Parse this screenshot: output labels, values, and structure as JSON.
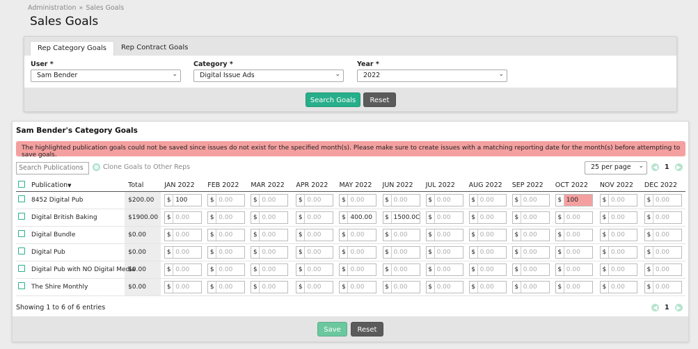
{
  "breadcrumb": {
    "parent": "Administration",
    "separator": "»",
    "current": "Sales Goals"
  },
  "page_title": "Sales Goals",
  "tabs": [
    {
      "label": "Rep Category Goals",
      "active": true
    },
    {
      "label": "Rep Contract Goals",
      "active": false
    }
  ],
  "filters": {
    "user": {
      "label": "User *",
      "value": "Sam Bender"
    },
    "category": {
      "label": "Category *",
      "value": "Digital Issue Ads"
    },
    "year": {
      "label": "Year *",
      "value": "2022"
    }
  },
  "buttons": {
    "search": "Search Goals",
    "reset": "Reset",
    "save": "Save",
    "reset_bottom": "Reset"
  },
  "goals": {
    "title": "Sam Bender's Category Goals",
    "alert": "The highlighted publication goals could not be saved since issues do not exist for the specified month(s). Please make sure to create issues with a matching reporting date for the month(s) before attempting to save goals.",
    "search_placeholder": "Search Publications",
    "clone_label": "Clone Goals to Other Reps",
    "per_page": "25 per page",
    "page": "1",
    "showing": "Showing 1 to 6 of 6 entries",
    "currency": "$",
    "placeholder": "0.00",
    "columns": {
      "publication": "Publication",
      "total": "Total",
      "months": [
        "JAN 2022",
        "FEB 2022",
        "MAR 2022",
        "APR 2022",
        "MAY 2022",
        "JUN 2022",
        "JUL 2022",
        "AUG 2022",
        "SEP 2022",
        "OCT 2022",
        "NOV 2022",
        "DEC 2022"
      ]
    },
    "rows": [
      {
        "publication": "8452 Digital Pub",
        "total": "$200.00",
        "months": [
          "100",
          "",
          "",
          "",
          "",
          "",
          "",
          "",
          "",
          "100",
          "",
          ""
        ],
        "errors": [
          9
        ]
      },
      {
        "publication": "Digital British Baking",
        "total": "$1900.00",
        "months": [
          "",
          "",
          "",
          "",
          "400.00",
          "1500.0C",
          "",
          "",
          "",
          "",
          "",
          ""
        ],
        "errors": []
      },
      {
        "publication": "Digital Bundle",
        "total": "$0.00",
        "months": [
          "",
          "",
          "",
          "",
          "",
          "",
          "",
          "",
          "",
          "",
          "",
          ""
        ],
        "errors": []
      },
      {
        "publication": "Digital Pub",
        "total": "$0.00",
        "months": [
          "",
          "",
          "",
          "",
          "",
          "",
          "",
          "",
          "",
          "",
          "",
          ""
        ],
        "errors": []
      },
      {
        "publication": "Digital Pub with NO Digital Media",
        "total": "$0.00",
        "months": [
          "",
          "",
          "",
          "",
          "",
          "",
          "",
          "",
          "",
          "",
          "",
          ""
        ],
        "errors": []
      },
      {
        "publication": "The Shire Monthly",
        "total": "$0.00",
        "months": [
          "",
          "",
          "",
          "",
          "",
          "",
          "",
          "",
          "",
          "",
          "",
          ""
        ],
        "errors": []
      }
    ]
  },
  "colors": {
    "accent": "#27ae8a",
    "error": "#f5a0a0",
    "button_gray": "#5b5b5b"
  }
}
